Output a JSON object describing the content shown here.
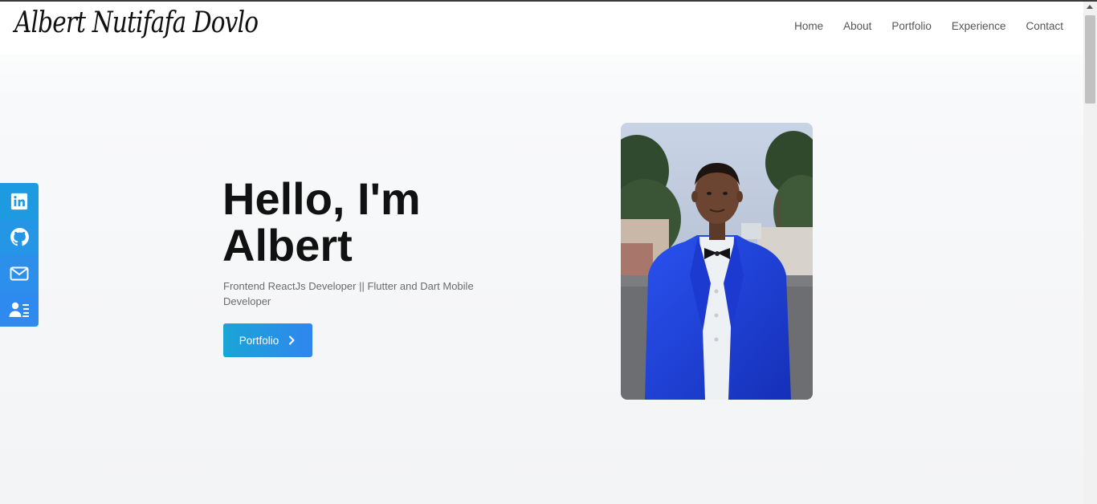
{
  "brand": {
    "name": "Albert Nutifafa Dovlo"
  },
  "nav": {
    "items": [
      {
        "label": "Home"
      },
      {
        "label": "About"
      },
      {
        "label": "Portfolio"
      },
      {
        "label": "Experience"
      },
      {
        "label": "Contact"
      }
    ]
  },
  "hero": {
    "title_line1": "Hello, I'm",
    "title_line2": "Albert",
    "subtitle": "Frontend ReactJs Developer || Flutter and Dart Mobile Developer",
    "button_label": "Portfolio"
  },
  "social": {
    "icons": [
      "linkedin-icon",
      "github-icon",
      "mail-icon",
      "contact-card-icon"
    ]
  },
  "colors": {
    "accent_start": "#1aa5d6",
    "accent_end": "#2f86ef",
    "suit": "#1e3fd6"
  }
}
